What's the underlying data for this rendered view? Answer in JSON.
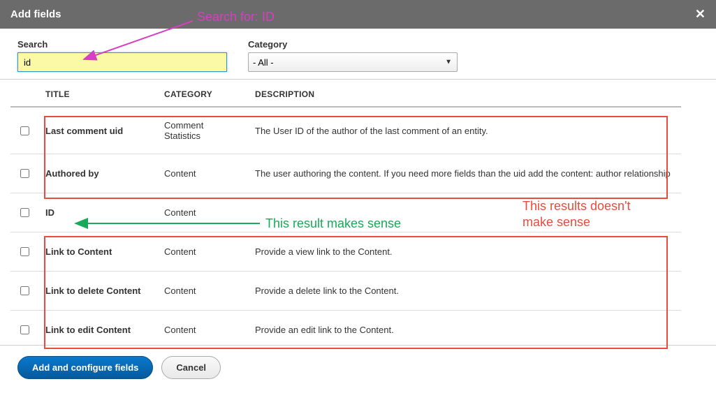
{
  "dialog": {
    "title": "Add fields",
    "close_symbol": "✕"
  },
  "filters": {
    "search_label": "Search",
    "search_value": "id",
    "category_label": "Category",
    "category_value": "- All -"
  },
  "table": {
    "headers": {
      "title": "TITLE",
      "category": "CATEGORY",
      "description": "DESCRIPTION"
    },
    "rows": [
      {
        "title": "Last comment uid",
        "category": "Comment Statistics",
        "description": "The User ID of the author of the last comment of an entity."
      },
      {
        "title": "Authored by",
        "category": "Content",
        "description": "The user authoring the content. If you need more fields than the uid add the content: author relationship"
      },
      {
        "title": "ID",
        "category": "Content",
        "description": ""
      },
      {
        "title": "Link to Content",
        "category": "Content",
        "description": "Provide a view link to the Content."
      },
      {
        "title": "Link to delete Content",
        "category": "Content",
        "description": "Provide a delete link to the Content."
      },
      {
        "title": "Link to edit Content",
        "category": "Content",
        "description": "Provide an edit link to the Content."
      }
    ]
  },
  "actions": {
    "primary": "Add and configure fields",
    "cancel": "Cancel"
  },
  "annotations": {
    "search_for": "Search for: ID",
    "makes_sense": "This result makes sense",
    "no_sense_line1": "This results doesn't",
    "no_sense_line2": "make sense"
  }
}
